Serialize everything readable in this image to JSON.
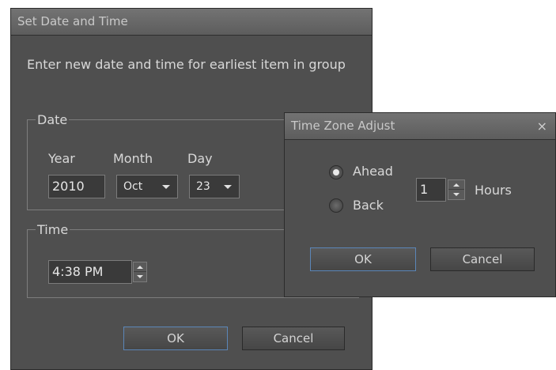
{
  "set_date_dialog": {
    "title": "Set Date and Time",
    "prompt": "Enter new date and time for earliest item in group",
    "date_group": {
      "legend": "Date",
      "year_label": "Year",
      "year_value": "2010",
      "month_label": "Month",
      "month_value": "Oct",
      "day_label": "Day",
      "day_value": "23"
    },
    "time_group": {
      "legend": "Time",
      "time_value": "4:38 PM"
    },
    "ok_label": "OK",
    "cancel_label": "Cancel"
  },
  "tz_dialog": {
    "title": "Time Zone Adjust",
    "close_glyph": "×",
    "ahead_label": "Ahead",
    "back_label": "Back",
    "hours_value": "1",
    "hours_label": "Hours",
    "selected": "Ahead",
    "ok_label": "OK",
    "cancel_label": "Cancel"
  },
  "colors": {
    "dialog_bg": "#4f4f4f",
    "titlebar": "#6a6a6a",
    "default_button_border": "#5b86b8"
  }
}
